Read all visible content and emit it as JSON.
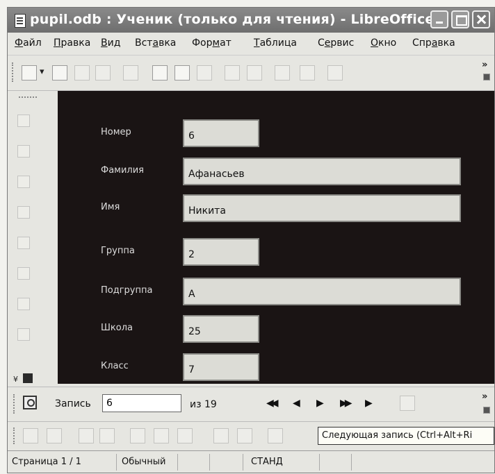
{
  "window": {
    "title": "pupil.odb : Ученик (только для чтения) - LibreOffice..."
  },
  "menu": [
    {
      "first": "Ф",
      "rest": "айл"
    },
    {
      "first": "П",
      "rest": "равка"
    },
    {
      "first": "В",
      "rest": "ид"
    },
    {
      "pre": "Вст",
      "first": "а",
      "rest": "вка"
    },
    {
      "pre": "Фор",
      "first": "м",
      "rest": "ат"
    },
    {
      "first": "Т",
      "rest": "аблица"
    },
    {
      "pre": "С",
      "first": "е",
      "rest": "рвис"
    },
    {
      "first": "О",
      "rest": "кно"
    },
    {
      "pre": "Спр",
      "first": "а",
      "rest": "вка"
    }
  ],
  "form": {
    "fields": [
      {
        "label": "Номер",
        "value": "6"
      },
      {
        "label": "Фамилия",
        "value": "Афанасьев"
      },
      {
        "label": "Имя",
        "value": "Никита"
      },
      {
        "label": "Группа",
        "value": "2"
      },
      {
        "label": "Подгруппа",
        "value": "А"
      },
      {
        "label": "Школа",
        "value": "25"
      },
      {
        "label": "Класс",
        "value": "7"
      }
    ]
  },
  "navigation": {
    "record_label": "Запись",
    "record_value": "6",
    "of_label": "из 19",
    "first_symbol": "◀◀",
    "prev_symbol": "◀",
    "next_symbol": "▶",
    "last_symbol": "▶▶",
    "new_symbol": "▶",
    "overflow": "»"
  },
  "tooltip": {
    "text": "Следующая запись (Ctrl+Alt+Ri"
  },
  "statusbar": {
    "page": "Страница  1 / 1",
    "style": "Обычный",
    "mode": "СТАНД"
  },
  "colors": {
    "form_background": "#1a1414",
    "field_background": "#dcdcd6"
  }
}
